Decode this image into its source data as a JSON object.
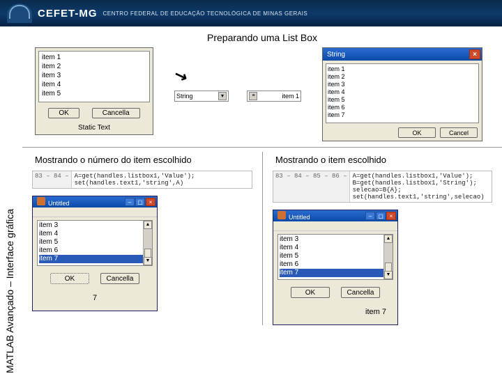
{
  "banner": {
    "title": "CEFET-MG",
    "subtitle": "CENTRO FEDERAL DE EDUCAÇÃO TECNOLÓGICA DE MINAS GERAIS"
  },
  "sidelabel": "MATLAB  Avançado – Interface gráfica",
  "slide_title": "Preparando uma List Box",
  "listbox1": {
    "items": [
      "item 1",
      "item 2",
      "item 3",
      "item 4",
      "item 5"
    ],
    "ok": "OK",
    "cancel": "Cancella",
    "static": "Static Text"
  },
  "mid": {
    "combo1": "String",
    "combo2": "item 1"
  },
  "string_dialog": {
    "title": "String",
    "lines": [
      "item 1",
      "item 2",
      "item 3",
      "item 4",
      "item 5",
      "item 6",
      "item 7"
    ],
    "ok": "OK",
    "cancel": "Cancel"
  },
  "col_left": {
    "title": "Mostrando o número do item escolhido",
    "gutter": "83 –\n84 –",
    "code": "A=get(handles.listbox1,'Value');\nset(handles.text1,'string',A)"
  },
  "col_right": {
    "title": "Mostrando o item escolhido",
    "gutter": "83 –\n84 –\n85 –\n86 –",
    "code": "A=get(handles.listbox1,'Value');\nB=get(handles.listbox1,'String');\nselecao=B{A};\nset(handles.text1,'string',selecao)"
  },
  "fig": {
    "title": "Untitled",
    "items": [
      "item 3",
      "item 4",
      "item 5",
      "item 6",
      "item 7"
    ],
    "selected_index": 4,
    "ok": "OK",
    "cancel": "Cancella",
    "result_number": "7",
    "result_text": "item 7"
  }
}
